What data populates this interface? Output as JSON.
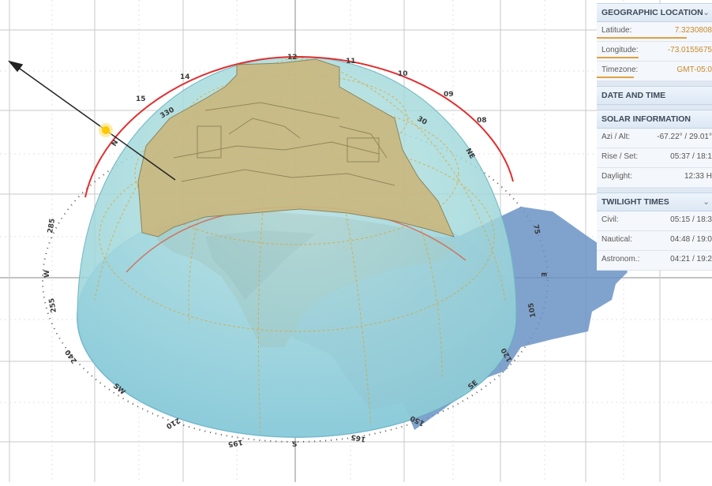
{
  "panel": {
    "geo_title": "GEOGRAPHIC LOCATION",
    "latitude_label": "Latitude:",
    "latitude_value": "7.3230808",
    "latitude_fill": 0.78,
    "longitude_label": "Longitude:",
    "longitude_value": "-73.0155675",
    "longitude_fill": 0.36,
    "timezone_label": "Timezone:",
    "timezone_value": "GMT-05:0",
    "timezone_fill": 0.32,
    "date_title": "DATE AND TIME",
    "solar_title": "SOLAR INFORMATION",
    "azi_label": "Azi / Alt:",
    "azi_value": "-67.22° / 29.01°",
    "rise_label": "Rise / Set:",
    "rise_value": "05:37 / 18:1",
    "daylight_label": "Daylight:",
    "daylight_value": "12:33 H",
    "twilight_title": "TWILIGHT TIMES",
    "civil_label": "Civil:",
    "civil_value": "05:15 / 18:3",
    "nautical_label": "Nautical:",
    "nautical_value": "04:48 / 19:0",
    "astro_label": "Astronom.:",
    "astro_value": "04:21 / 19:2"
  },
  "compass": {
    "north": "N",
    "northeast": "NE",
    "east": "E",
    "west": "W",
    "south": "S",
    "northwest_label": "NW",
    "southeast": "SE",
    "southwest": "SW",
    "deg_285": "285",
    "deg_255": "255",
    "deg_240": "240",
    "deg_210": "210",
    "deg_195": "195",
    "deg_165": "165",
    "deg_150": "150",
    "deg_120": "120",
    "deg_105": "105",
    "deg_75": "75",
    "deg_30": "30",
    "deg_330": "330",
    "hour_12": "12",
    "hour_14": "14",
    "hour_15": "15",
    "hour_11": "11",
    "hour_10": "10",
    "hour_09": "09",
    "hour_08": "08"
  },
  "colors": {
    "dome": "#a8dcdc",
    "horizon": "#7ab4ec",
    "sunpath": "#e03030",
    "sun": "#ffc800",
    "building": "#c9b880",
    "shadow": "#6a93c6",
    "grid": "#b8b8b8"
  },
  "icons": {
    "geo_toggle": "chevron-down-icon",
    "twilight_toggle": "chevron-down-icon",
    "sun": "sun-icon",
    "arrow": "sun-direction-arrow-icon"
  }
}
